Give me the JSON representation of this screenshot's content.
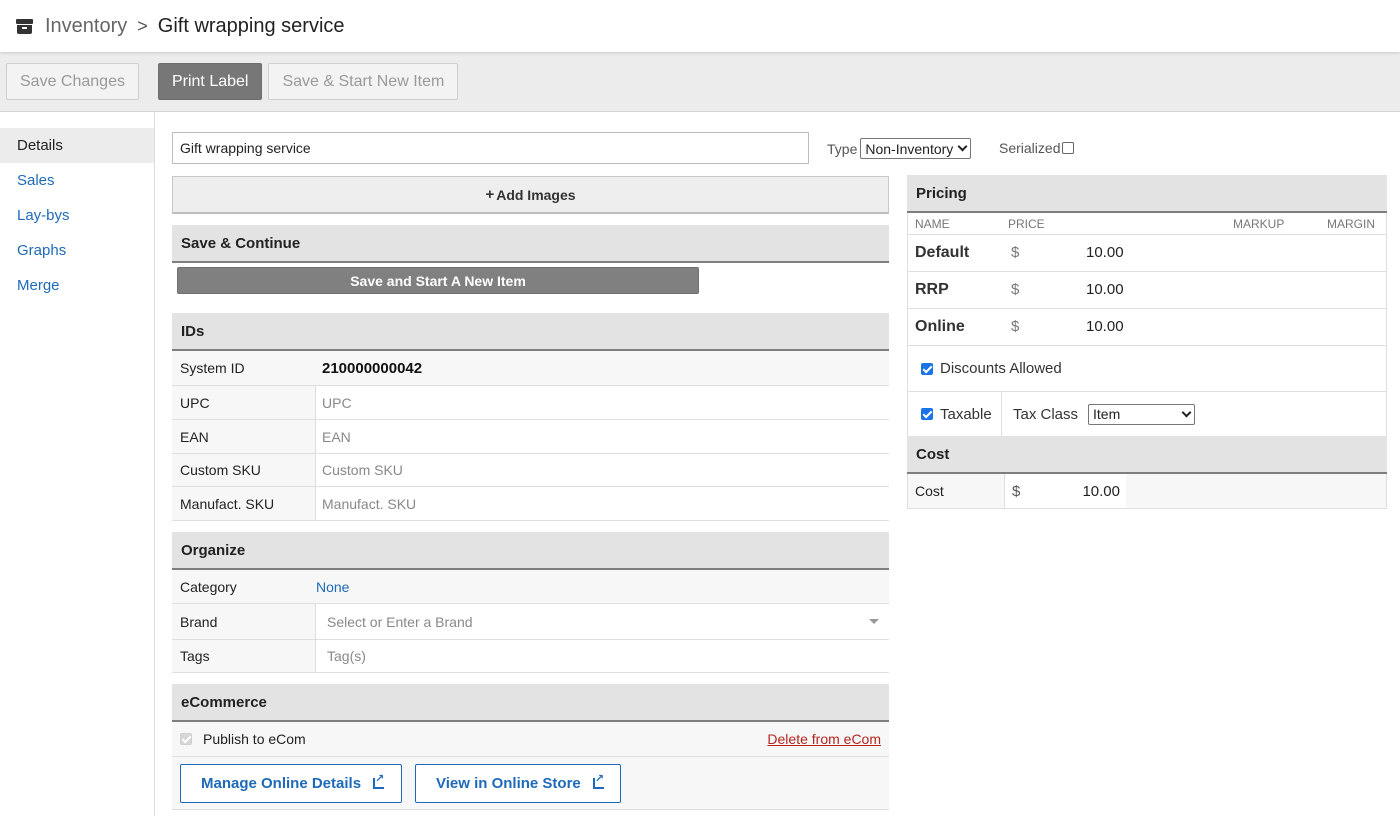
{
  "header": {
    "breadcrumb_root": "Inventory",
    "breadcrumb_separator": ">",
    "title": "Gift wrapping service",
    "icon": "inventory-box-icon"
  },
  "toolbar": {
    "save_changes": "Save Changes",
    "print_label": "Print Label",
    "save_start_new": "Save & Start New Item"
  },
  "sidebar": {
    "items": [
      {
        "label": "Details",
        "active": true
      },
      {
        "label": "Sales"
      },
      {
        "label": "Lay-bys"
      },
      {
        "label": "Graphs"
      },
      {
        "label": "Merge"
      }
    ]
  },
  "item": {
    "name": "Gift wrapping service",
    "type_label": "Type",
    "type_value": "Non-Inventory",
    "serialized_label": "Serialized",
    "serialized_checked": false
  },
  "images": {
    "add_label": "Add Images"
  },
  "save_continue": {
    "heading": "Save & Continue",
    "button": "Save and Start A New Item"
  },
  "ids": {
    "heading": "IDs",
    "rows": [
      {
        "label": "System ID",
        "value": "210000000042"
      },
      {
        "label": "UPC",
        "placeholder": "UPC"
      },
      {
        "label": "EAN",
        "placeholder": "EAN"
      },
      {
        "label": "Custom SKU",
        "placeholder": "Custom SKU"
      },
      {
        "label": "Manufact. SKU",
        "placeholder": "Manufact. SKU"
      }
    ]
  },
  "organize": {
    "heading": "Organize",
    "category_label": "Category",
    "category_value": "None",
    "brand_label": "Brand",
    "brand_placeholder": "Select or Enter a Brand",
    "tags_label": "Tags",
    "tags_placeholder": "Tag(s)"
  },
  "ecommerce": {
    "heading": "eCommerce",
    "publish_label": "Publish to eCom",
    "publish_checked": true,
    "delete_link": "Delete from eCom",
    "manage_button": "Manage Online Details",
    "view_button": "View in Online Store"
  },
  "pricing": {
    "heading": "Pricing",
    "columns": {
      "name": "NAME",
      "price": "PRICE",
      "markup": "MARKUP",
      "margin": "MARGIN"
    },
    "rows": [
      {
        "name": "Default",
        "currency": "$",
        "amount": "10.00"
      },
      {
        "name": "RRP",
        "currency": "$",
        "amount": "10.00"
      },
      {
        "name": "Online",
        "currency": "$",
        "amount": "10.00"
      }
    ],
    "discounts_label": "Discounts Allowed",
    "discounts_checked": true,
    "taxable_label": "Taxable",
    "taxable_checked": true,
    "tax_class_label": "Tax Class",
    "tax_class_value": "Item"
  },
  "cost": {
    "heading": "Cost",
    "label": "Cost",
    "currency": "$",
    "amount": "10.00"
  },
  "colors": {
    "link": "#1e6ab8",
    "delete_link": "#b3261e",
    "checkbox": "#1a73e8"
  }
}
